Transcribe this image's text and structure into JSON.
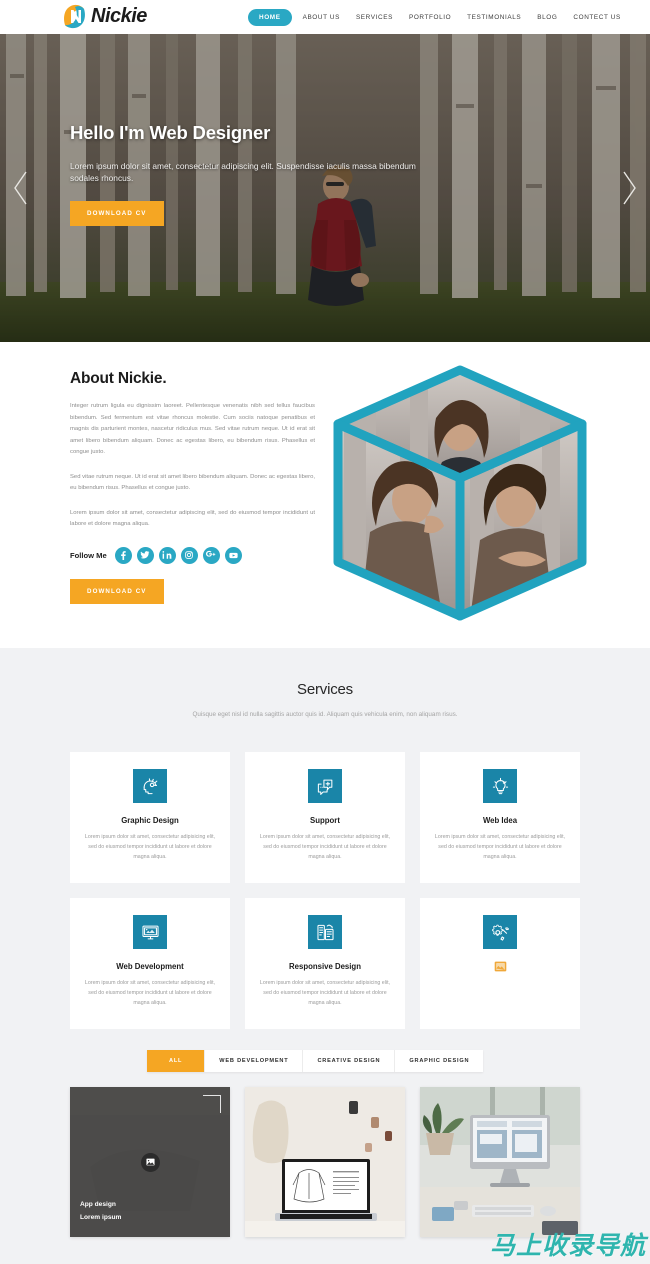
{
  "header": {
    "logo_text": "Nickie",
    "logo_icon": "nickie-n-monogram-icon",
    "nav": [
      {
        "label": "HOME",
        "active": true
      },
      {
        "label": "ABOUT US",
        "active": false
      },
      {
        "label": "SERVICES",
        "active": false
      },
      {
        "label": "PORTFOLIO",
        "active": false
      },
      {
        "label": "TESTIMONIALS",
        "active": false
      },
      {
        "label": "BLOG",
        "active": false
      },
      {
        "label": "CONTECT US",
        "active": false
      }
    ]
  },
  "hero": {
    "title": "Hello I'm Web Designer",
    "subtitle": "Lorem ipsum dolor sit amet, consectetur adipiscing elit. Suspendisse iaculis massa bibendum sodales rhoncus.",
    "cta_label": "DOWNLOAD CV",
    "prev_icon": "chevron-left-icon",
    "next_icon": "chevron-right-icon"
  },
  "about": {
    "title": "About Nickie.",
    "paragraph1": "Integer rutrum ligula eu dignissim laoreet. Pellentesque venenatis nibh sed tellus faucibus bibendum. Sed fermentum est vitae rhoncus molestie. Cum sociis natoque penatibus et magnis dis parturient montes, nascetur ridiculus mus. Sed vitae rutrum neque. Ut id erat sit amet libero bibendum aliquam. Donec ac egestas libero, eu bibendum risus. Phasellus et congue justo.",
    "paragraph2": "Sed vitae rutrum neque. Ut id erat sit amet libero bibendum aliquam. Donec ac egestas libero, eu bibendum risus. Phasellus et congue justo.",
    "paragraph3": "Lorem ipsum dolor sit amet, consectetur adipiscing elit, sed do eiusmod tempor incididunt ut labore et dolore magna aliqua.",
    "follow_label": "Follow Me",
    "social": [
      {
        "name": "facebook-icon",
        "glyph": "f"
      },
      {
        "name": "twitter-icon",
        "glyph": "t"
      },
      {
        "name": "linkedin-icon",
        "glyph": "in"
      },
      {
        "name": "instagram-icon",
        "glyph": "ig"
      },
      {
        "name": "google-plus-icon",
        "glyph": "G+"
      },
      {
        "name": "youtube-icon",
        "glyph": "yt"
      }
    ],
    "cta_label": "DOWNLOAD CV",
    "cube_alt": "three-photo-isometric-cube"
  },
  "services": {
    "title": "Services",
    "subtitle": "Quisque eget nisl id nulla sagittis auctor quis id. Aliquam quis vehicula enim, non aliquam risus.",
    "body_text": "Lorem ipsum dolor sit amet, consectetur adipisicing elit, sed do eiusmod tempor incididunt ut labore et dolore magna aliqua.",
    "cards": [
      {
        "title": "Graphic Design",
        "icon": "head-idea-icon",
        "has_text": true,
        "broken": false
      },
      {
        "title": "Support",
        "icon": "chat-support-icon",
        "has_text": true,
        "broken": false
      },
      {
        "title": "Web Idea",
        "icon": "lightbulb-idea-icon",
        "has_text": true,
        "broken": false
      },
      {
        "title": "Web Development",
        "icon": "monitor-code-icon",
        "has_text": true,
        "broken": false
      },
      {
        "title": "Responsive Design",
        "icon": "responsive-devices-icon",
        "has_text": true,
        "broken": false
      },
      {
        "title": "",
        "icon": "gear-wrench-icon",
        "has_text": false,
        "broken": true
      }
    ]
  },
  "portfolio": {
    "filters": [
      {
        "label": "ALL",
        "active": true
      },
      {
        "label": "WEB DEVELOPMENT",
        "active": false
      },
      {
        "label": "CREATIVE DESIGN",
        "active": false
      },
      {
        "label": "GRAPHIC DESIGN",
        "active": false
      }
    ],
    "items": [
      {
        "title": "App design",
        "subtitle": "Lorem ipsum",
        "hovered": true,
        "zoom_icon": "image-icon"
      },
      {
        "title": "",
        "subtitle": "",
        "hovered": false,
        "zoom_icon": "image-icon"
      },
      {
        "title": "",
        "subtitle": "",
        "hovered": false,
        "zoom_icon": "image-icon"
      }
    ]
  },
  "watermark": {
    "text": "马上收录导航"
  },
  "colors": {
    "teal": "#2aa8c4",
    "icon_teal": "#1a85a8",
    "orange": "#f5a623",
    "gray_bg": "#f1f2f4",
    "watermark_teal": "#2fb5ae"
  }
}
